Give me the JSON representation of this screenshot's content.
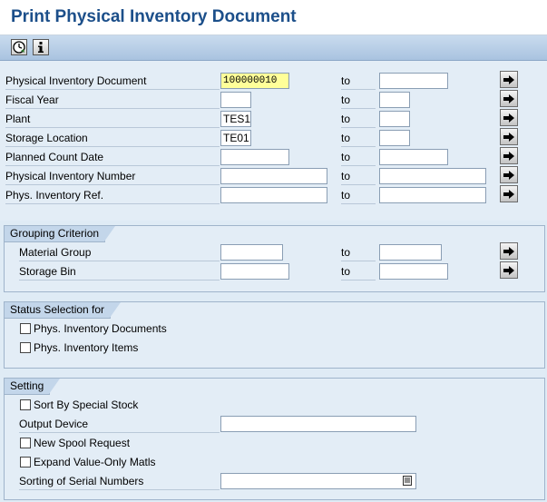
{
  "title": "Print Physical Inventory Document",
  "toolbar": {
    "execute_icon": "execute-clock-icon",
    "info_icon": "info-icon"
  },
  "main_rows": [
    {
      "label": "Physical Inventory Document",
      "from": "100000010",
      "to_label": "to",
      "to": ""
    },
    {
      "label": "Fiscal Year",
      "from": "",
      "to_label": "to",
      "to": ""
    },
    {
      "label": "Plant",
      "from": "TES1",
      "to_label": "to",
      "to": ""
    },
    {
      "label": "Storage Location",
      "from": "TE01",
      "to_label": "to",
      "to": ""
    },
    {
      "label": "Planned Count Date",
      "from": "",
      "to_label": "to",
      "to": ""
    },
    {
      "label": "Physical Inventory Number",
      "from": "",
      "to_label": "to",
      "to": ""
    },
    {
      "label": "Phys. Inventory Ref.",
      "from": "",
      "to_label": "to",
      "to": ""
    }
  ],
  "grouping": {
    "title": "Grouping Criterion",
    "rows": [
      {
        "label": "Material Group",
        "from": "",
        "to_label": "to",
        "to": ""
      },
      {
        "label": "Storage Bin",
        "from": "",
        "to_label": "to",
        "to": ""
      }
    ]
  },
  "status": {
    "title": "Status Selection for",
    "items": [
      {
        "label": "Phys. Inventory Documents",
        "checked": false
      },
      {
        "label": "Phys. Inventory Items",
        "checked": false
      }
    ]
  },
  "setting": {
    "title": "Setting",
    "sort_special_stock": "Sort By Special Stock",
    "output_device_label": "Output Device",
    "output_device_value": "",
    "new_spool": "New Spool Request",
    "expand_value_only": "Expand Value-Only Matls",
    "sorting_serial_label": "Sorting of Serial Numbers",
    "sorting_serial_value": ""
  }
}
